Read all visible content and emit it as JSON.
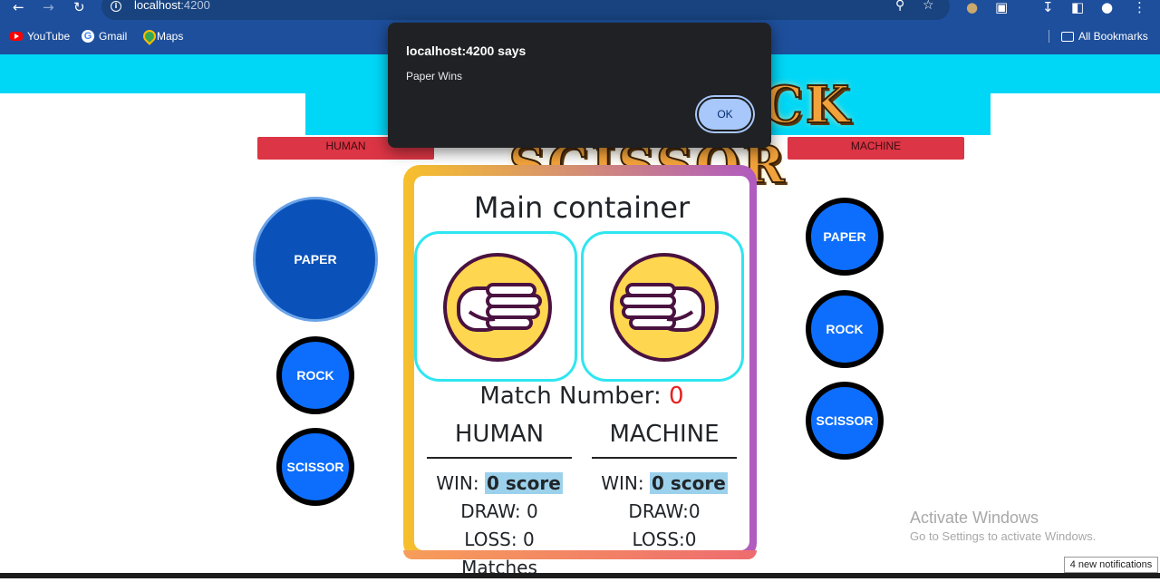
{
  "browser": {
    "url_host": "localhost",
    "url_port": ":4200",
    "bookmarks": [
      {
        "label": "YouTube",
        "icon": "youtube-icon"
      },
      {
        "label": "Gmail",
        "icon": "google-icon"
      },
      {
        "label": "Maps",
        "icon": "maps-icon"
      }
    ],
    "all_bookmarks_label": "All Bookmarks"
  },
  "banner": {
    "title": "PAPER ROCK SCISSOR"
  },
  "labels": {
    "human": "HUMAN",
    "machine": "MACHINE"
  },
  "human_choices": [
    "PAPER",
    "ROCK",
    "SCISSOR"
  ],
  "machine_choices": [
    "PAPER",
    "ROCK",
    "SCISSOR"
  ],
  "main": {
    "title": "Main container",
    "match_label": "Match Number: ",
    "match_number": "0",
    "human": {
      "heading": "HUMAN",
      "win_label": "WIN: ",
      "win_value": "0 score",
      "draw": "DRAW: 0",
      "loss": "LOSS: 0 Matches"
    },
    "machine": {
      "heading": "MACHINE",
      "win_label": "WIN: ",
      "win_value": "0 score",
      "draw": "DRAW:0",
      "loss": "LOSS:0"
    }
  },
  "dialog": {
    "title": "localhost:4200 says",
    "message": "Paper Wins",
    "ok_label": "OK"
  },
  "os": {
    "activate_title": "Activate Windows",
    "activate_sub": "Go to Settings to activate Windows.",
    "notifications": "4 new notifications"
  },
  "colors": {
    "accent_blue": "#0d6efd",
    "label_red": "#dc3545",
    "cyan": "#00d7f7"
  }
}
